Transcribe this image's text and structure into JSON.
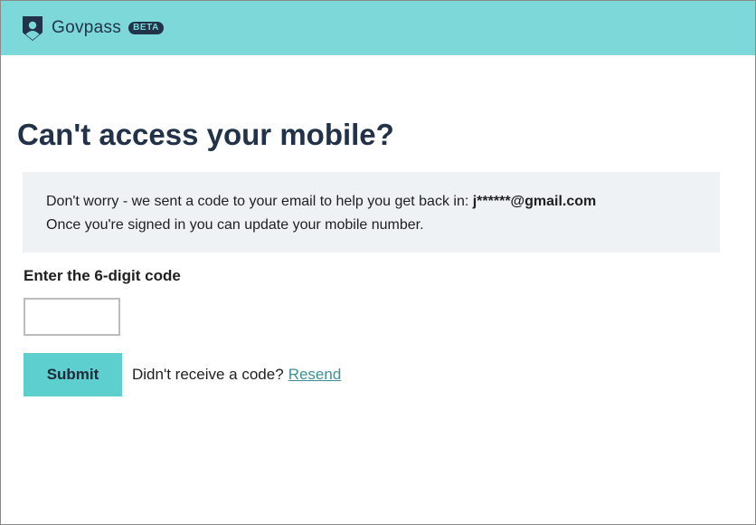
{
  "header": {
    "brand_name": "Govpass",
    "beta_label": "BETA"
  },
  "page": {
    "title": "Can't access your mobile?"
  },
  "notice": {
    "line1_prefix": "Don't worry - we sent a code to your email to help you get back in: ",
    "email_masked": "j******@gmail.com",
    "line2": "Once you're signed in you can update your mobile number."
  },
  "form": {
    "code_label": "Enter the 6-digit code",
    "code_value": "",
    "submit_label": "Submit",
    "resend_prompt": "Didn't receive a code?",
    "resend_link": "Resend"
  },
  "colors": {
    "header_bg": "#7dd9d9",
    "title": "#223349",
    "button_bg": "#5dcfcf",
    "link": "#3e8f96",
    "notice_bg": "#eef2f4"
  },
  "icons": {
    "brand_logo": "shield-person-icon"
  }
}
